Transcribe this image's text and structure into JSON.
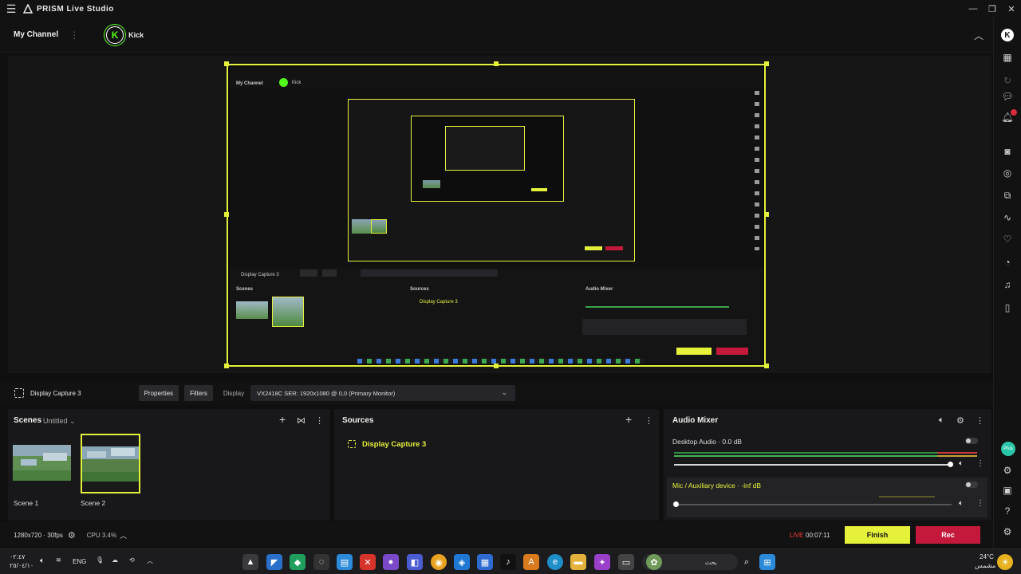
{
  "app": {
    "title": "PRISM Live Studio"
  },
  "channel": {
    "label": "My Channel",
    "platform": "Kick"
  },
  "source_toolbar": {
    "source_name": "Display Capture 3",
    "properties_label": "Properties",
    "filters_label": "Filters",
    "display_label": "Display",
    "display_value": "VX2418C SER: 1920x1080 @ 0,0 (Primary Monitor)"
  },
  "scenes": {
    "title": "Scenes",
    "collection": "Untitled",
    "items": [
      {
        "label": "Scene 1"
      },
      {
        "label": "Scene 2",
        "selected": true
      }
    ]
  },
  "sources": {
    "title": "Sources",
    "items": [
      {
        "label": "Display Capture 3"
      }
    ]
  },
  "audio_mixer": {
    "title": "Audio Mixer",
    "channels": [
      {
        "label": "Desktop Audio",
        "level": "0.0 dB",
        "volume": 0.93
      },
      {
        "label": "Mic / Auxiliary device",
        "level": "-inf dB",
        "volume": 0.0
      }
    ]
  },
  "status": {
    "resolution": "1280x720 · 30fps",
    "cpu": "CPU 3.4%",
    "live_label": "LIVE",
    "live_time": "00:07:11",
    "finish_label": "Finish",
    "rec_label": "Rec"
  },
  "taskbar": {
    "clock_time": "٠٢:٤٧",
    "clock_date": "٢٥/٠٤/١٠",
    "lang": "ENG",
    "search_placeholder": "بحث",
    "weather_temp": "24°C",
    "weather_desc": "مشمس",
    "plus_badge": "Plus"
  },
  "colors": {
    "accent": "#e4f13a",
    "rec": "#c5193c",
    "live": "#ff3b3b",
    "kick": "#53fc18"
  }
}
